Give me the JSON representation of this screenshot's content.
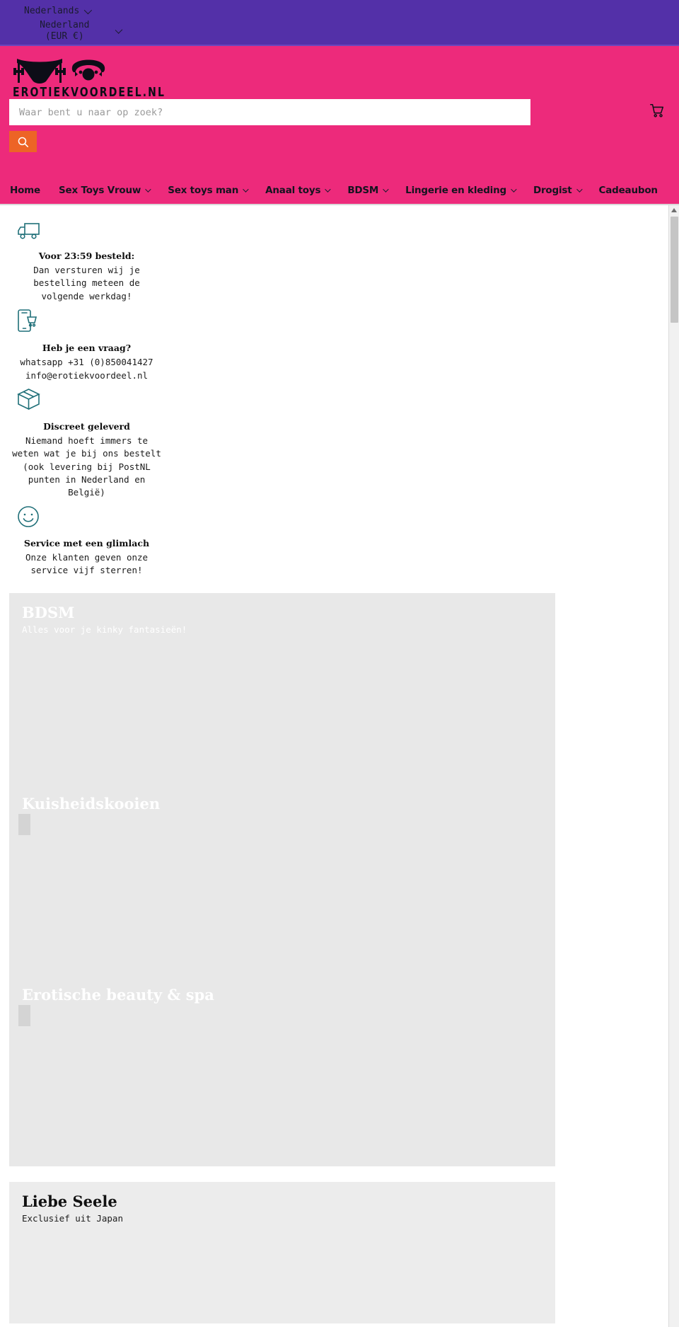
{
  "topbar": {
    "language": "Nederlands",
    "country": "Nederland (EUR €)",
    "language_chevron_icon": "chevron-down-icon",
    "country_chevron_icon": "chevron-down-icon"
  },
  "header": {
    "logo_text": "EROTIEKVOORDEEL.NL",
    "logo_icon": "lingerie-and-gag-logo",
    "search": {
      "placeholder": "Waar bent u naar op zoek?",
      "value": "",
      "button_icon": "search-icon"
    },
    "cart_icon": "shopping-cart-icon",
    "colors": {
      "brand_pink": "#ed2a7b",
      "accent_orange": "#ed6426",
      "topbar_purple": "#5330a8",
      "usp_teal": "#1f6f78"
    }
  },
  "nav": {
    "items": [
      {
        "label": "Home",
        "has_dropdown": false
      },
      {
        "label": "Sex Toys Vrouw",
        "has_dropdown": true
      },
      {
        "label": "Sex toys man",
        "has_dropdown": true
      },
      {
        "label": "Anaal toys",
        "has_dropdown": true
      },
      {
        "label": "BDSM",
        "has_dropdown": true
      },
      {
        "label": "Lingerie en kleding",
        "has_dropdown": true
      },
      {
        "label": "Drogist",
        "has_dropdown": true
      },
      {
        "label": "Cadeaubon",
        "has_dropdown": false
      }
    ]
  },
  "usps": [
    {
      "icon": "delivery-truck-icon",
      "title": "Voor 23:59 besteld:",
      "text": "Dan versturen wij je bestelling meteen de volgende werkdag!"
    },
    {
      "icon": "mobile-shopping-icon",
      "title": "Heb je een vraag?",
      "text": "whatsapp +31 (0)850041427 info@erotiekvoordeel.nl"
    },
    {
      "icon": "package-box-icon",
      "title": "Discreet geleverd",
      "text": "Niemand hoeft immers te weten wat je bij ons bestelt (ook levering bij PostNL punten in Nederland en België)"
    },
    {
      "icon": "smiley-face-icon",
      "title": "Service met een glimlach",
      "text": "Onze klanten geven onze service vijf sterren!"
    }
  ],
  "collections": [
    {
      "title": "BDSM",
      "subtitle": "Alles voor je kinky fantasieën!",
      "style": "white-text"
    },
    {
      "title": "Kuisheidskooien",
      "subtitle": "",
      "style": "white-text"
    },
    {
      "title": "Erotische beauty & spa",
      "subtitle": "",
      "style": "white-text"
    },
    {
      "title": "Liebe Seele",
      "subtitle": "Exclusief uit Japan",
      "style": "dark-text"
    }
  ],
  "scrollbar": {
    "up_arrow_icon": "scroll-up-arrow-icon"
  }
}
